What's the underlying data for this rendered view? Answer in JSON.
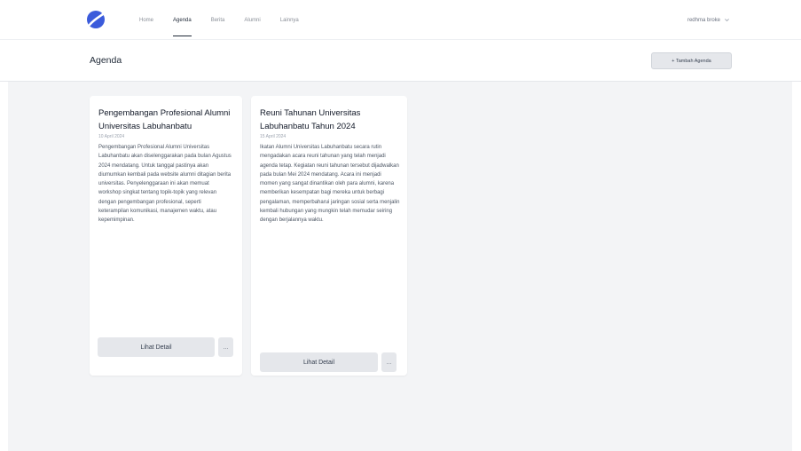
{
  "nav": {
    "links": [
      {
        "label": "Home"
      },
      {
        "label": "Agenda"
      },
      {
        "label": "Berita"
      },
      {
        "label": "Alumni"
      },
      {
        "label": "Lainnya"
      }
    ],
    "active_index": 1,
    "user_name": "redhma broke",
    "brand_color": "#3b5bdb"
  },
  "header": {
    "title": "Agenda",
    "add_label": "+ Tambah Agenda"
  },
  "cards": [
    {
      "title": "Pengembangan Profesional Alumni Universitas Labuhanbatu",
      "date": "10 April 2024",
      "body": "Pengembangan Profesional Alumni Universitas Labuhanbatu akan diselenggarakan pada bulan Agustus 2024 mendatang. Untuk tanggal pastinya akan diumumkan kembali pada website alumni ditagian berita universitas. Penyelenggaraan ini akan memuat workshop singkat tentang topik-topik yang relevan dengan pengembangan profesional, seperti keterampilan komunikasi, manajemen waktu, atau kepemimpinan.",
      "detail_label": "Lihat Detail",
      "more_label": "..."
    },
    {
      "title": "Reuni Tahunan Universitas Labuhanbatu Tahun 2024",
      "date": "15 April 2024",
      "body": "Ikatan Alumni Universitas Labuhanbatu secara rutin mengadakan acara reuni tahunan yang telah menjadi agenda tetap. Kegiatan reuni tahunan tersebut dijadwalkan pada bulan Mei 2024 mendatang. Acara ini menjadi momen yang sangat dinantikan oleh para alumni, karena memberikan kesempatan bagi mereka untuk berbagi pengalaman, memperbaharui jaringan sosial serta menjalin kembali hubungan yang mungkin telah memudar seiring dengan berjalannya waktu.",
      "detail_label": "Lihat Detail",
      "more_label": "..."
    }
  ]
}
